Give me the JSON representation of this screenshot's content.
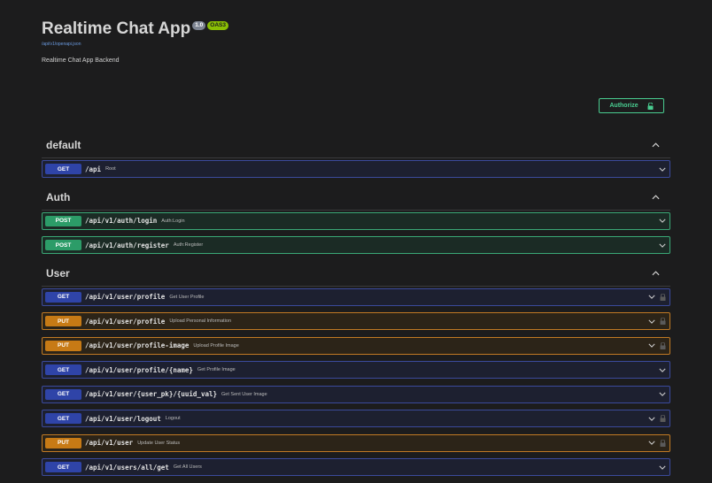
{
  "info": {
    "title": "Realtime Chat App",
    "version": "1.0",
    "oas": "OAS3",
    "spec_url": "/api/v1/openapi.json",
    "description": "Realtime Chat App Backend"
  },
  "authorize_label": "Authorize",
  "colors": {
    "get": "#2f44a8",
    "post": "#2c9c68",
    "put": "#c77a15",
    "authorize": "#49cc90"
  },
  "tags": [
    {
      "name": "default",
      "operations": [
        {
          "method": "GET",
          "path": "/api",
          "summary": "Root",
          "locked": false
        }
      ]
    },
    {
      "name": "Auth",
      "operations": [
        {
          "method": "POST",
          "path": "/api/v1/auth/login",
          "summary": "Auth:Login",
          "locked": false
        },
        {
          "method": "POST",
          "path": "/api/v1/auth/register",
          "summary": "Auth:Register",
          "locked": false
        }
      ]
    },
    {
      "name": "User",
      "operations": [
        {
          "method": "GET",
          "path": "/api/v1/user/profile",
          "summary": "Get User Profile",
          "locked": true
        },
        {
          "method": "PUT",
          "path": "/api/v1/user/profile",
          "summary": "Upload Personal Information",
          "locked": true
        },
        {
          "method": "PUT",
          "path": "/api/v1/user/profile-image",
          "summary": "Upload Profile Image",
          "locked": true
        },
        {
          "method": "GET",
          "path": "/api/v1/user/profile/{name}",
          "summary": "Get Profile Image",
          "locked": false
        },
        {
          "method": "GET",
          "path": "/api/v1/user/{user_pk}/{uuid_val}",
          "summary": "Get Sent User Image",
          "locked": false
        },
        {
          "method": "GET",
          "path": "/api/v1/user/logout",
          "summary": "Logout",
          "locked": true
        },
        {
          "method": "PUT",
          "path": "/api/v1/user",
          "summary": "Update User Status",
          "locked": true
        },
        {
          "method": "GET",
          "path": "/api/v1/users/all/get",
          "summary": "Get All Users",
          "locked": false
        }
      ]
    }
  ]
}
